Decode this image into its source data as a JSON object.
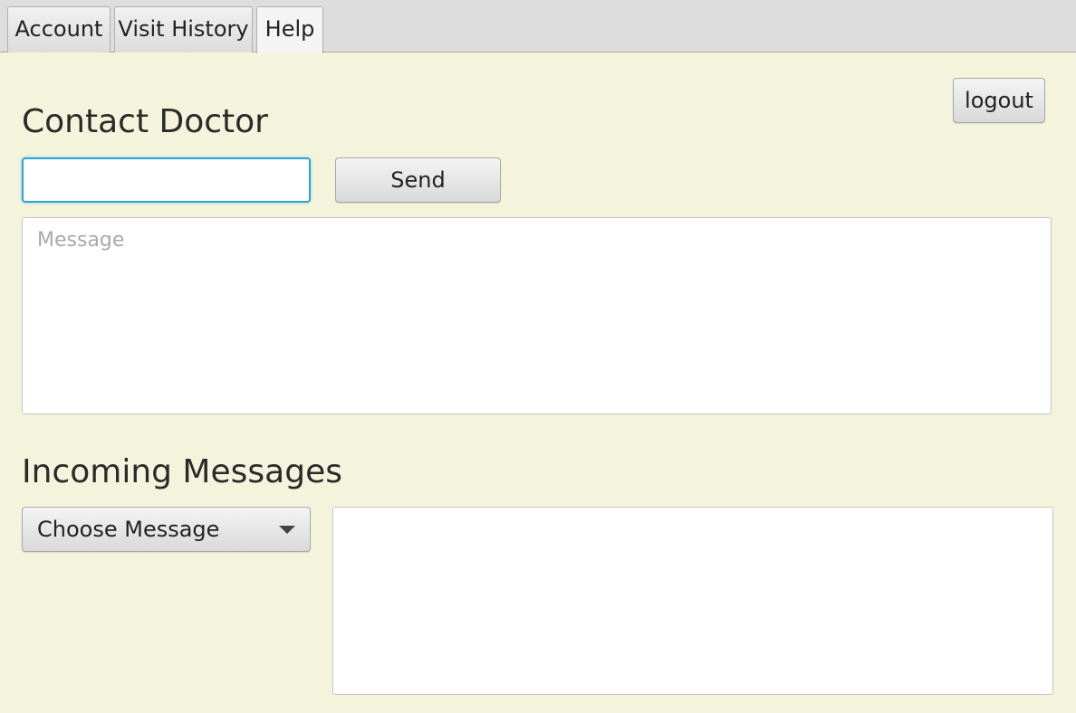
{
  "tabs": [
    {
      "label": "Account"
    },
    {
      "label": "Visit History"
    },
    {
      "label": "Help"
    }
  ],
  "contact": {
    "heading": "Contact Doctor",
    "recipient_value": "",
    "send_label": "Send",
    "message_placeholder": "Message",
    "message_value": ""
  },
  "logout_label": "logout",
  "incoming": {
    "heading": "Incoming Messages",
    "select_value": "Choose Message",
    "message_body": ""
  },
  "colors": {
    "background": "#f4f4dc",
    "focus_ring": "#2ba4d8"
  }
}
